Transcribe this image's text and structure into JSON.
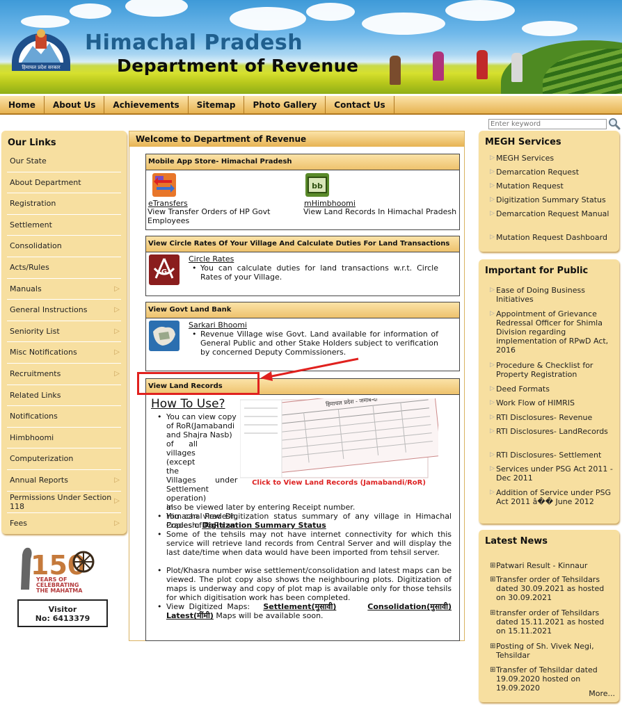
{
  "header": {
    "title_line1": "Himachal Pradesh",
    "title_line2": "Department of Revenue",
    "logo_caption": "हिमाचल प्रदेश सरकार"
  },
  "nav": [
    "Home",
    "About Us",
    "Achievements",
    "Sitemap",
    "Photo Gallery",
    "Contact Us"
  ],
  "search": {
    "placeholder": "Enter keyword"
  },
  "left_sidebar": {
    "title": "Our Links",
    "items": [
      {
        "label": "Our State",
        "arrow": false
      },
      {
        "label": "About Department",
        "arrow": false
      },
      {
        "label": "Registration",
        "arrow": false
      },
      {
        "label": "Settlement",
        "arrow": false
      },
      {
        "label": "Consolidation",
        "arrow": false
      },
      {
        "label": "Acts/Rules",
        "arrow": false
      },
      {
        "label": "Manuals",
        "arrow": true
      },
      {
        "label": "General Instructions",
        "arrow": true
      },
      {
        "label": "Seniority List",
        "arrow": true
      },
      {
        "label": "Misc Notifications",
        "arrow": true
      },
      {
        "label": "Recruitments",
        "arrow": true
      },
      {
        "label": "Related Links",
        "arrow": false
      },
      {
        "label": "Notifications",
        "arrow": false
      },
      {
        "label": "Himbhoomi",
        "arrow": false
      },
      {
        "label": "Computerization",
        "arrow": false
      },
      {
        "label": "Annual Reports",
        "arrow": true
      },
      {
        "label": "Permissions Under Section 118",
        "arrow": true
      },
      {
        "label": "Fees",
        "arrow": true
      }
    ]
  },
  "gandhi": {
    "big": "150",
    "line1": "YEARS OF",
    "line2": "CELEBRATING",
    "line3": "THE MAHATMA"
  },
  "visitor": {
    "label": "Visitor",
    "count": "No: 6413379"
  },
  "center": {
    "title": "Welcome to Department of Revenue",
    "mobile": {
      "title": "Mobile App Store- Himachal Pradesh",
      "app1_link": "eTransfers",
      "app1_desc": "View Transfer Orders of HP Govt Employees",
      "app2_link": "mHimbhoomi",
      "app2_desc": "View Land Records In Himachal Pradesh"
    },
    "circle": {
      "title": "View Circle Rates Of Your Village And Calculate Duties For Land Transactions",
      "link": "Circle Rates",
      "bullet": "You can calculate duties for land transactions w.r.t. Circle Rates of your Village."
    },
    "landbank": {
      "title": "View Govt Land Bank",
      "link": "Sarkari Bhoomi",
      "bullet": "Revenue Village wise Govt. Land available for information of General Public and other Stake Holders subject to verification by concerned Deputy Commissioners."
    },
    "records": {
      "title": "View Land Records",
      "howto": "How To Use?",
      "img_caption": "Click to View Land Records (Jamabandi/RoR)",
      "img_header": "हिमाचल प्रदेश - जमाबन्दी",
      "b1_wrap": [
        "You can view copy",
        "of RoR(Jamabandi",
        "and Shajra Nasb)",
        "of all villages",
        "(except the",
        "Villages under",
        "Settlement",
        "operation) in",
        "Himachal Pradesh.",
        "Copies of RoR can"
      ],
      "b1_tail": "also be viewed later by entering Receipt number.",
      "b2_text": "You can view Digitization status summary of any village in Himachal Pradesh:",
      "b2_link": "Digitization Summary Status",
      "b3": "Some of the tehsils may not have internet connectivity for which this service will retrieve land records from Central Server and will display the last date/time when data would have been imported from tehsil server.",
      "b4": "Plot/Khasra number wise settlement/consolidation and latest maps can be viewed. The plot copy also shows the neighbouring plots. Digitization of maps is underway and copy of plot map is available only for those tehsils for which digitisation work has been completed.",
      "b5_prefix": "View Digitized Maps:",
      "b5_link1": "Settlement(मुसावी)",
      "b5_link2": "Consolidation(मुसावी)",
      "b5_link3": "Latest(मींमी)",
      "b5_suffix": "Maps will be available soon."
    }
  },
  "megh": {
    "title": "MEGH Services",
    "items": [
      "MEGH Services",
      "Demarcation Request",
      "Mutation Request",
      "Digitization Summary Status",
      "Demarcation Request Manual",
      "Mutation Request Dashboard"
    ]
  },
  "important": {
    "title": "Important for Public",
    "items": [
      "Ease of Doing Business Initiatives",
      "Appointment of Grievance Redressal Officer for Shimla Division regarding implementation of RPwD Act, 2016",
      "Procedure & Checklist for Property Registration",
      "Deed Formats",
      "Work Flow of HIMRIS",
      "RTI Disclosures- Revenue",
      "RTI Disclosures- LandRecords",
      "RTI Disclosures- Settlement",
      "Services under PSG Act 2011 - Dec 2011",
      "Addition of Service under PSG Act 2011 â�� June 2012"
    ]
  },
  "news": {
    "title": "Latest News",
    "items": [
      "Patwari Result - Kinnaur",
      "Transfer order of Tehsildars dated 30.09.2021 as hosted on 30.09.2021",
      "transfer order of Tehsildars dated 15.11.2021 as hosted on 15.11.2021",
      "Posting of Sh. Vivek Negi, Tehsildar",
      "Transfer of Tehsildar dated 19.09.2020 hosted on 19.09.2020"
    ],
    "more": "More..."
  }
}
